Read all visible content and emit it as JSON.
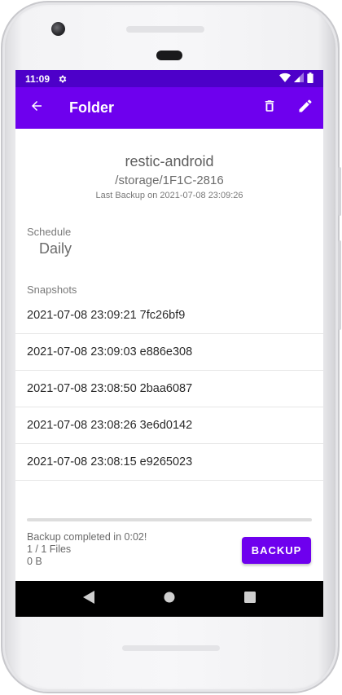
{
  "status_bar": {
    "time": "11:09"
  },
  "app_bar": {
    "title": "Folder"
  },
  "folder": {
    "name": "restic-android",
    "path": "/storage/1F1C-2816",
    "last_backup": "Last Backup on 2021-07-08 23:09:26"
  },
  "schedule": {
    "label": "Schedule",
    "value": "Daily"
  },
  "snapshots": {
    "label": "Snapshots",
    "items": [
      "2021-07-08 23:09:21 7fc26bf9",
      "2021-07-08 23:09:03 e886e308",
      "2021-07-08 23:08:50 2baa6087",
      "2021-07-08 23:08:26 3e6d0142",
      "2021-07-08 23:08:15 e9265023"
    ]
  },
  "backup": {
    "status_line1": "Backup completed in 0:02!",
    "status_line2": "1 / 1 Files",
    "status_line3": "0 B",
    "button_label": "BACKUP",
    "progress": 0
  },
  "colors": {
    "primary": "#6e00ee",
    "status_bar": "#4d00c9"
  },
  "icons": {
    "status": [
      "gear-icon",
      "wifi-icon",
      "signal-icon",
      "battery-icon"
    ],
    "app_bar": [
      "back-arrow-icon",
      "delete-icon",
      "edit-icon"
    ],
    "nav": [
      "nav-back-icon",
      "nav-home-icon",
      "nav-recents-icon"
    ]
  }
}
